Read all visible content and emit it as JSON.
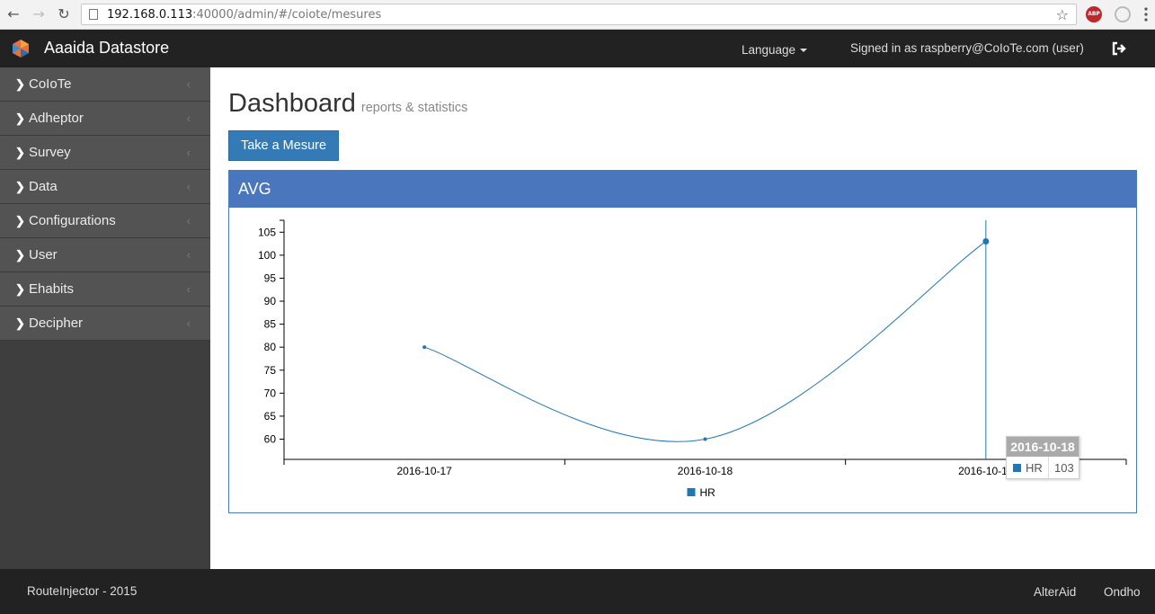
{
  "browser": {
    "url_host": "192.168.0.113",
    "url_path": ":40000/admin/#/coiote/mesures",
    "abp_label": "ABP"
  },
  "header": {
    "brand": "Aaaida Datastore",
    "language": "Language",
    "signed_in": "Signed in as raspberry@CoIoTe.com (user)"
  },
  "sidebar": {
    "items": [
      {
        "label": "CoIoTe"
      },
      {
        "label": "Adheptor"
      },
      {
        "label": "Survey"
      },
      {
        "label": "Data"
      },
      {
        "label": "Configurations"
      },
      {
        "label": "User"
      },
      {
        "label": "Ehabits"
      },
      {
        "label": "Decipher"
      }
    ]
  },
  "main": {
    "title": "Dashboard",
    "subtitle": "reports & statistics",
    "button": "Take a Mesure",
    "panel_title": "AVG"
  },
  "chart_data": {
    "type": "line",
    "categories": [
      "2016-10-17",
      "2016-10-18",
      "2016-10-18"
    ],
    "series": [
      {
        "name": "HR",
        "values": [
          80,
          60,
          103
        ],
        "color": "#1f77b4"
      }
    ],
    "yticks": [
      60,
      65,
      70,
      75,
      80,
      85,
      90,
      95,
      100,
      105
    ],
    "ylim": [
      55.6,
      107.6
    ],
    "legend": "bottom-center",
    "grid": false
  },
  "tooltip": {
    "title": "2016-10-18",
    "series": "HR",
    "value": "103"
  },
  "footer": {
    "left": "RouteInjector - 2015",
    "link1": "AlterAid",
    "link2": "Ondho"
  }
}
